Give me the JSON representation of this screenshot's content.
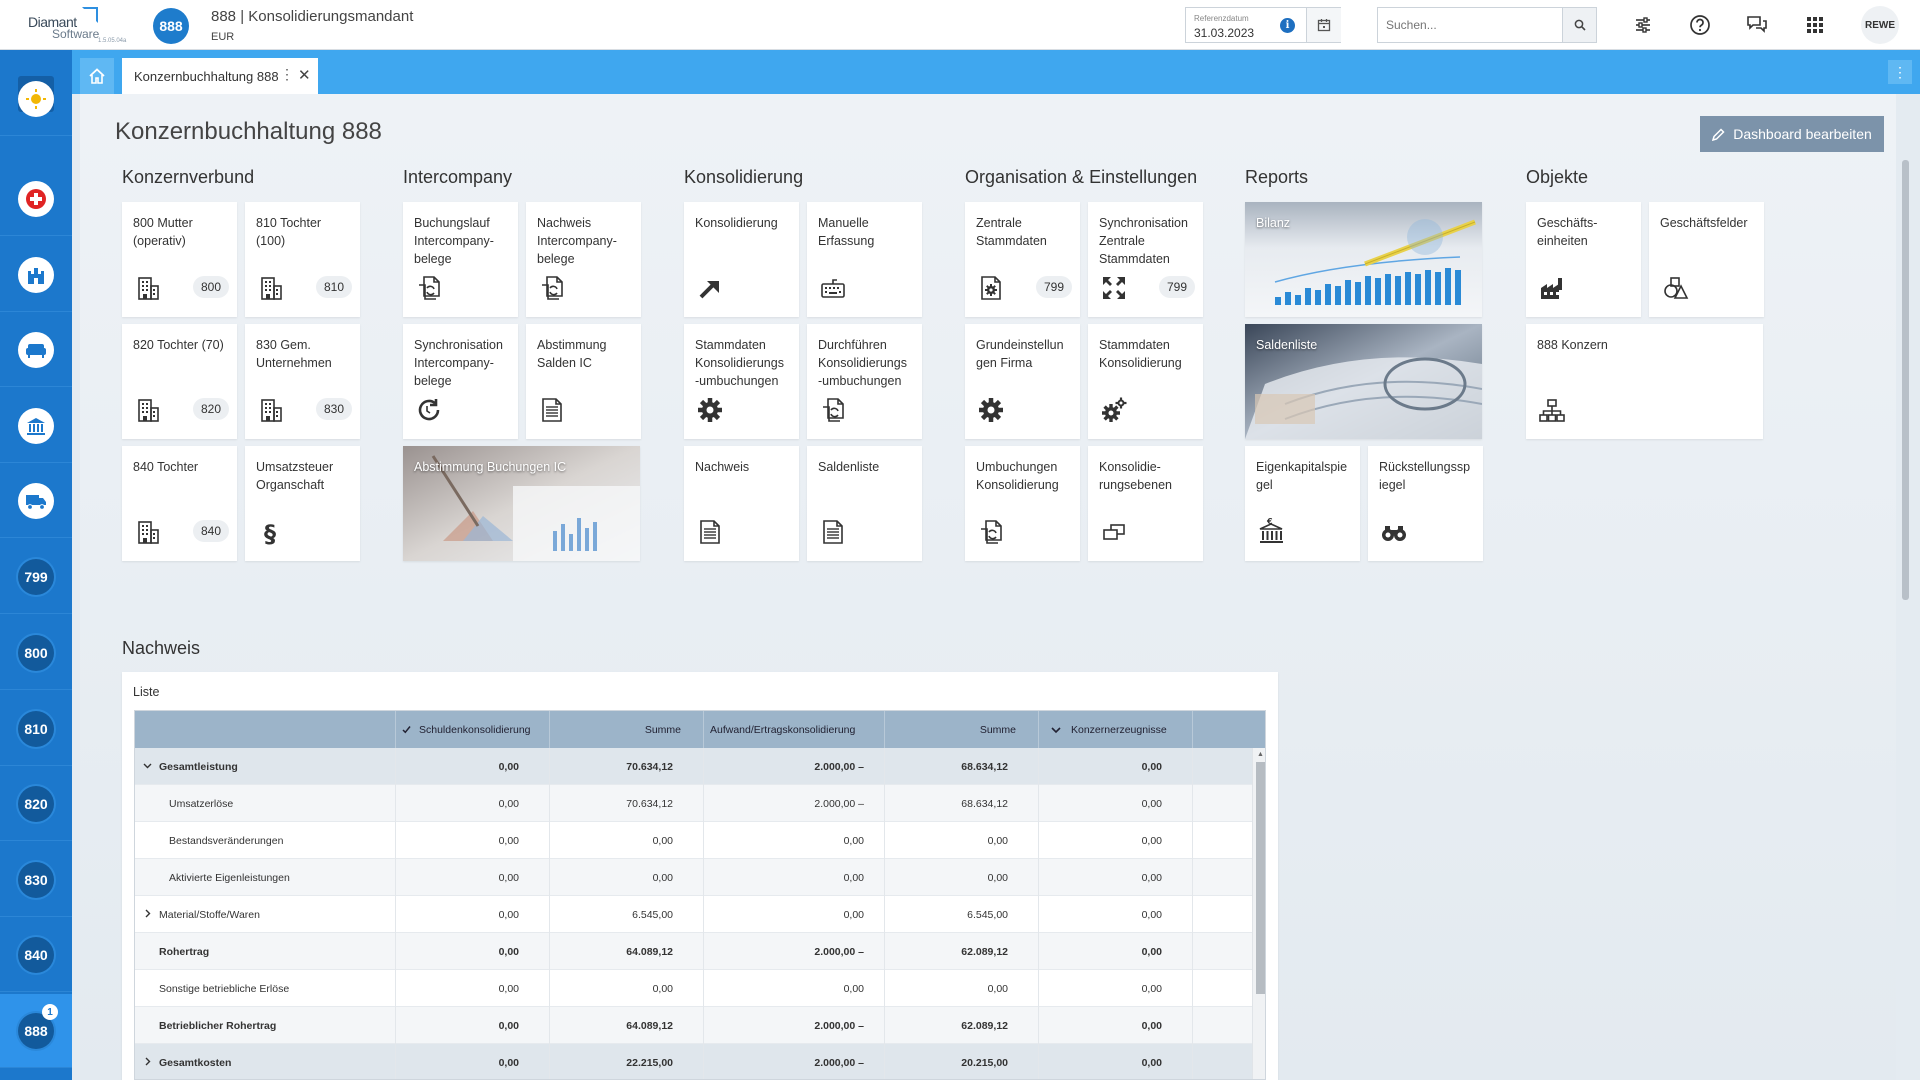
{
  "app": {
    "logo_line1": "Diamant",
    "logo_line2": "Software",
    "version": "1.5.05.04a",
    "mandant_number": "888",
    "mandant_title": "888 | Konsolidierungsmandant",
    "currency": "EUR",
    "refdate_label": "Referenzdatum",
    "refdate_value": "31.03.2023",
    "search_placeholder": "Suchen...",
    "user_initials": "REWE"
  },
  "sidebar": {
    "toggle_icon": "chevron-right-icon",
    "items": [
      {
        "type": "icon",
        "icon": "sun-icon"
      },
      {
        "type": "icon",
        "icon": "medical-cross-icon"
      },
      {
        "type": "icon",
        "icon": "castle-icon"
      },
      {
        "type": "icon",
        "icon": "sofa-icon"
      },
      {
        "type": "icon",
        "icon": "bank-icon"
      },
      {
        "type": "icon",
        "icon": "truck-icon"
      },
      {
        "type": "num",
        "label": "799"
      },
      {
        "type": "num",
        "label": "800"
      },
      {
        "type": "num",
        "label": "810"
      },
      {
        "type": "num",
        "label": "820"
      },
      {
        "type": "num",
        "label": "830"
      },
      {
        "type": "num",
        "label": "840"
      },
      {
        "type": "num",
        "label": "888",
        "notification": "1",
        "active": true
      }
    ]
  },
  "tabs": {
    "home_icon": "home-icon",
    "active_tab": "Konzernbuchhaltung 888"
  },
  "page": {
    "title": "Konzernbuchhaltung 888",
    "edit_button": "Dashboard bearbeiten"
  },
  "sections": [
    {
      "title": "Konzernverbund",
      "tiles": [
        {
          "label": "800 Mutter (operativ)",
          "icon": "building-icon",
          "badge": "800"
        },
        {
          "label": "810 Tochter (100)",
          "icon": "building-icon",
          "badge": "810"
        },
        {
          "label": "820 Tochter (70)",
          "icon": "building-icon",
          "badge": "820"
        },
        {
          "label": "830 Gem. Unternehmen",
          "icon": "building-icon",
          "badge": "830"
        },
        {
          "label": "840 Tochter",
          "icon": "building-icon",
          "badge": "840"
        },
        {
          "label": "Umsatzsteuer Organschaft",
          "icon": "paragraph-icon"
        }
      ]
    },
    {
      "title": "Intercompany",
      "tiles": [
        {
          "label": "Buchungslauf Intercompany-belege",
          "icon": "document-exchange-icon"
        },
        {
          "label": "Nachweis Intercompany-belege",
          "icon": "document-exchange-icon"
        },
        {
          "label": "Synchronisation Intercompany-belege",
          "icon": "sync-icon"
        },
        {
          "label": "Abstimmung Salden IC",
          "icon": "document-list-icon"
        },
        {
          "label": "Abstimmung Buchungen IC",
          "image": "report-photo",
          "wide": true
        }
      ]
    },
    {
      "title": "Konsolidierung",
      "tiles": [
        {
          "label": "Konsolidierung",
          "icon": "arrow-up-right-icon"
        },
        {
          "label": "Manuelle Erfassung",
          "icon": "keyboard-icon"
        },
        {
          "label": "Stammdaten Konsolidierungs -umbuchungen",
          "icon": "gear-icon"
        },
        {
          "label": "Durchführen Konsolidierungs -umbuchungen",
          "icon": "document-exchange-icon"
        },
        {
          "label": "Nachweis",
          "icon": "document-list-icon"
        },
        {
          "label": "Saldenliste",
          "icon": "document-list-icon"
        }
      ]
    },
    {
      "title": "Organisation & Einstellungen",
      "tiles": [
        {
          "label": "Zentrale Stammdaten",
          "icon": "gear-document-icon",
          "badge": "799"
        },
        {
          "label": "Synchronisation Zentrale Stammdaten",
          "icon": "expand-arrows-icon",
          "badge": "799"
        },
        {
          "label": "Grundeinstellun gen Firma",
          "icon": "gear-icon"
        },
        {
          "label": "Stammdaten Konsolidierung",
          "icon": "gears-icon"
        },
        {
          "label": "Umbuchungen Konsolidierung",
          "icon": "document-exchange-icon"
        },
        {
          "label": "Konsolidie-rungsebenen",
          "icon": "layers-icon"
        }
      ]
    },
    {
      "title": "Reports",
      "tiles": [
        {
          "label": "Bilanz",
          "image": "chart-photo",
          "wide": true
        },
        {
          "label": "Saldenliste",
          "image": "papers-photo",
          "wide": true
        },
        {
          "label": "Eigenkapitalspie gel",
          "icon": "bank-euro-icon"
        },
        {
          "label": "Rückstellungssp iegel",
          "icon": "binoculars-icon"
        }
      ]
    },
    {
      "title": "Objekte",
      "tiles": [
        {
          "label": "Geschäfts-einheiten",
          "icon": "factory-icon"
        },
        {
          "label": "Geschäftsfelder",
          "icon": "shapes-icon"
        },
        {
          "label": "888 Konzern",
          "icon": "org-chart-icon",
          "wide": true
        }
      ]
    }
  ],
  "nachweis": {
    "title": "Nachweis",
    "list_label": "Liste",
    "columns": [
      "",
      "Schuldenkonsolidierung",
      "Summe",
      "Aufwand/Ertragskonsolidierung",
      "Summe",
      "Konzernerzeugnisse"
    ],
    "rows": [
      {
        "label": "Gesamtleistung",
        "expander": "down",
        "level": 0,
        "bold": true,
        "group": true,
        "values": [
          "0,00",
          "70.634,12",
          "2.000,00 –",
          "68.634,12",
          "0,00"
        ]
      },
      {
        "label": "Umsatzerlöse",
        "level": 1,
        "values": [
          "0,00",
          "70.634,12",
          "2.000,00 –",
          "68.634,12",
          "0,00"
        ]
      },
      {
        "label": "Bestandsveränderungen",
        "level": 1,
        "values": [
          "0,00",
          "0,00",
          "0,00",
          "0,00",
          "0,00"
        ]
      },
      {
        "label": "Aktivierte Eigenleistungen",
        "level": 1,
        "values": [
          "0,00",
          "0,00",
          "0,00",
          "0,00",
          "0,00"
        ]
      },
      {
        "label": "Material/Stoffe/Waren",
        "expander": "right",
        "level": 0,
        "values": [
          "0,00",
          "6.545,00",
          "0,00",
          "6.545,00",
          "0,00"
        ]
      },
      {
        "label": "Rohertrag",
        "level": 0,
        "bold": true,
        "values": [
          "0,00",
          "64.089,12",
          "2.000,00 –",
          "62.089,12",
          "0,00"
        ]
      },
      {
        "label": "Sonstige betriebliche Erlöse",
        "level": 0,
        "values": [
          "0,00",
          "0,00",
          "0,00",
          "0,00",
          "0,00"
        ]
      },
      {
        "label": "Betrieblicher Rohertrag",
        "level": 0,
        "bold": true,
        "values": [
          "0,00",
          "64.089,12",
          "2.000,00 –",
          "62.089,12",
          "0,00"
        ]
      },
      {
        "label": "Gesamtkosten",
        "expander": "right",
        "level": 0,
        "bold": true,
        "group": true,
        "values": [
          "0,00",
          "22.215,00",
          "2.000,00 –",
          "20.215,00",
          "0,00"
        ]
      }
    ]
  },
  "colors": {
    "sidebar": "#1c78cc",
    "tabbar": "#3fa7ef",
    "accent": "#1e7ccc",
    "edit_button": "#7c93aa"
  }
}
